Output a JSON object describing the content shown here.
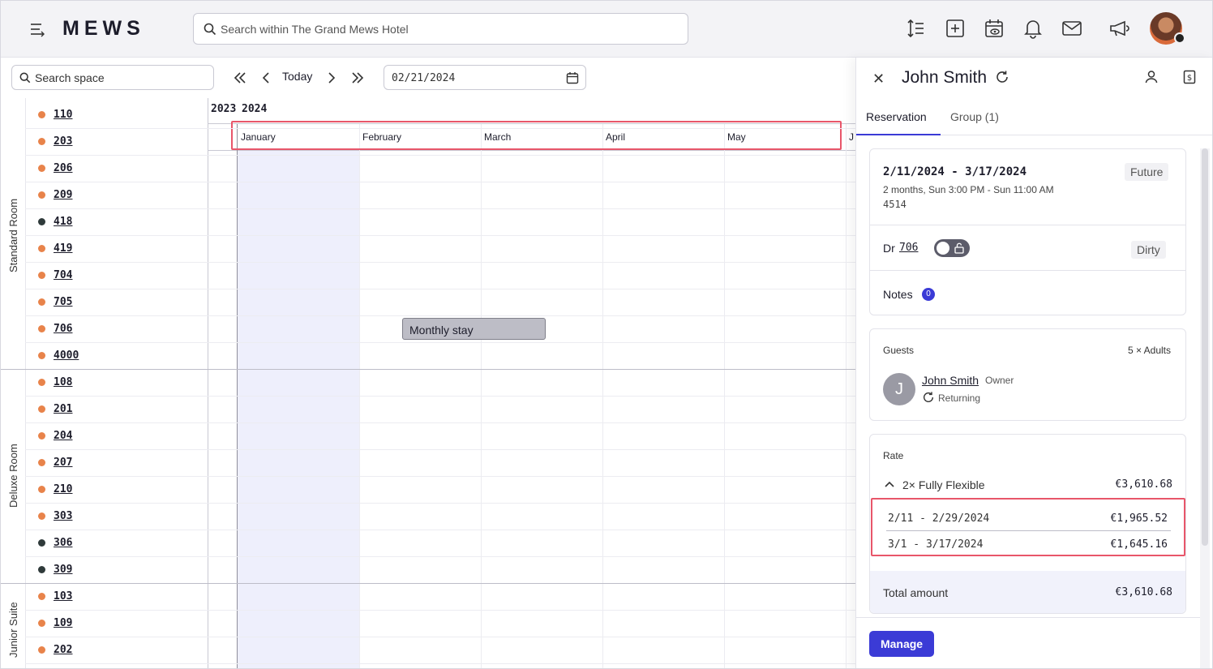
{
  "app": {
    "logo": "MEWS"
  },
  "header": {
    "search_placeholder": "Search within The Grand Mews Hotel",
    "icons": [
      "menu-icon",
      "sort-icon",
      "add-icon",
      "calendar-eye-icon",
      "bell-icon",
      "mail-icon",
      "megaphone-icon"
    ]
  },
  "toolbar": {
    "space_search_placeholder": "Search space",
    "today_label": "Today",
    "date_value": "02/21/2024"
  },
  "timeline": {
    "years": [
      "2023",
      "2024"
    ],
    "months": [
      "January",
      "February",
      "March",
      "April",
      "May",
      "J"
    ],
    "booking_label": "Monthly stay"
  },
  "groups": [
    {
      "name": "Standard Room",
      "rooms": [
        {
          "number": "110",
          "status": "dirty"
        },
        {
          "number": "203",
          "status": "dirty"
        },
        {
          "number": "206",
          "status": "dirty"
        },
        {
          "number": "209",
          "status": "dirty"
        },
        {
          "number": "418",
          "status": "ooo"
        },
        {
          "number": "419",
          "status": "dirty"
        },
        {
          "number": "704",
          "status": "dirty"
        },
        {
          "number": "705",
          "status": "dirty"
        },
        {
          "number": "706",
          "status": "dirty"
        },
        {
          "number": "4000",
          "status": "dirty"
        }
      ]
    },
    {
      "name": "Deluxe Room",
      "rooms": [
        {
          "number": "108",
          "status": "dirty"
        },
        {
          "number": "201",
          "status": "dirty"
        },
        {
          "number": "204",
          "status": "dirty"
        },
        {
          "number": "207",
          "status": "dirty"
        },
        {
          "number": "210",
          "status": "dirty"
        },
        {
          "number": "303",
          "status": "dirty"
        },
        {
          "number": "306",
          "status": "ooo"
        },
        {
          "number": "309",
          "status": "ooo"
        }
      ]
    },
    {
      "name": "Junior Suite",
      "rooms": [
        {
          "number": "103",
          "status": "dirty"
        },
        {
          "number": "109",
          "status": "dirty"
        },
        {
          "number": "202",
          "status": "dirty"
        }
      ]
    }
  ],
  "colors": {
    "dirty": "#e8834a",
    "ooo": "#2f3a3a",
    "accent": "#3b3bd6",
    "highlight": "#e8566a"
  },
  "panel": {
    "title": "John Smith",
    "tabs": [
      "Reservation",
      "Group (1)"
    ],
    "reservation": {
      "dates": "2/11/2024 - 3/17/2024",
      "status": "Future",
      "details": "2 months, Sun 3:00 PM - Sun 11:00 AM",
      "number": "4514",
      "room_prefix": "Dr",
      "room": "706",
      "room_state": "Dirty",
      "notes_label": "Notes",
      "notes_count": "0"
    },
    "guests": {
      "label": "Guests",
      "count": "5 × Adults",
      "initial": "J",
      "name": "John Smith",
      "role": "Owner",
      "status": "Returning"
    },
    "rate": {
      "label": "Rate",
      "name": "2× Fully Flexible",
      "amount": "€3,610.68",
      "lines": [
        {
          "period": "2/11 - 2/29/2024",
          "amount": "€1,965.52"
        },
        {
          "period": "3/1 - 3/17/2024",
          "amount": "€1,645.16"
        }
      ],
      "total_label": "Total amount",
      "total": "€3,610.68"
    },
    "manage_label": "Manage"
  }
}
